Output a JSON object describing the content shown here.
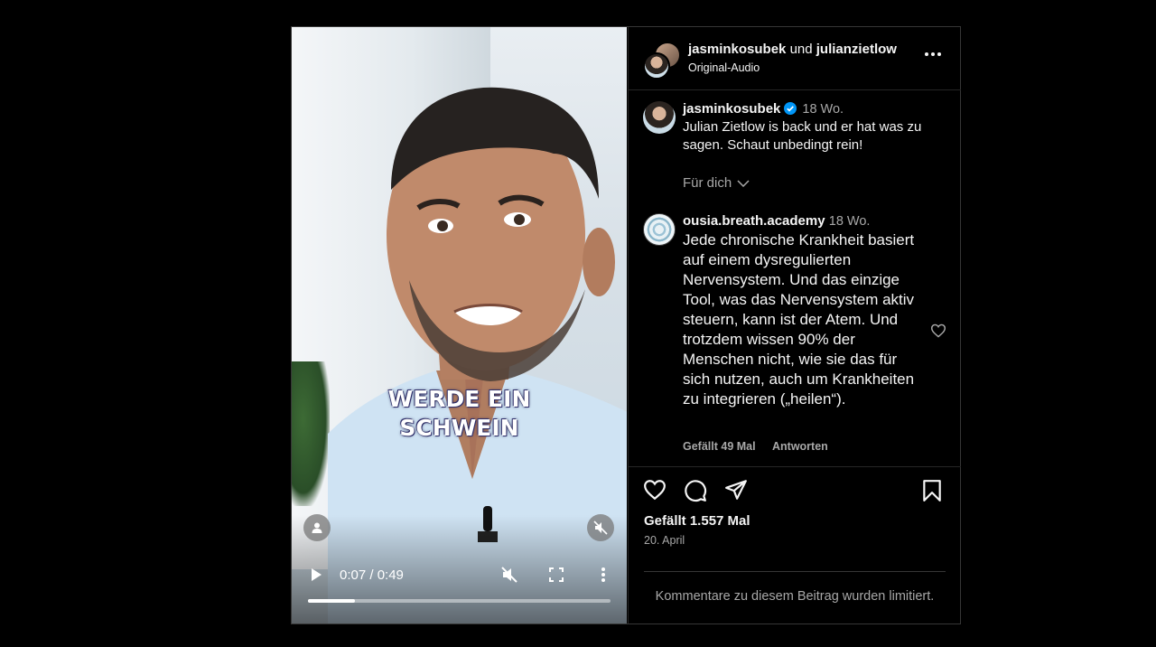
{
  "video": {
    "caption_line1": "WERDE EIN",
    "caption_line2": "SCHWEIN",
    "time_display": "0:07 / 0:49",
    "progress_fraction": 0.155
  },
  "header": {
    "user1": "jasminkosubek",
    "connector": "und",
    "user2": "julianzietlow",
    "audio": "Original-Audio"
  },
  "comments": [
    {
      "username": "jasminkosubek",
      "verified": true,
      "age": "18 Wo.",
      "text": "Julian Zietlow is back und er hat was zu sagen. Schaut unbedingt rein!",
      "tag": "Für dich"
    },
    {
      "username": "ousia.breath.academy",
      "age": "18 Wo.",
      "text": "Jede chronische Krankheit basiert auf einem dysregulierten Nervensystem. Und das einzige Tool, was das Nervensystem aktiv steuern, kann ist der Atem. Und trotzdem wissen 90% der Menschen nicht, wie sie das für sich nutzen, auch um Krankheiten zu integrieren („heilen“).",
      "likes": "Gefällt 49 Mal",
      "reply": "Antworten"
    }
  ],
  "footer": {
    "likes": "Gefällt 1.557 Mal",
    "date": "20. April",
    "limited": "Kommentare zu diesem Beitrag wurden limitiert."
  },
  "icons": [
    "person-icon",
    "mute-icon",
    "play-icon",
    "mute-toggle-icon",
    "fullscreen-icon",
    "more-vertical-icon",
    "more-horizontal-icon",
    "verified-icon",
    "chevron-down-icon",
    "heart-icon",
    "comment-icon",
    "share-icon",
    "bookmark-icon"
  ],
  "colors": {
    "background": "#000000",
    "border": "#262626",
    "muted_text": "#a8a8a8",
    "verified": "#0095f6"
  }
}
